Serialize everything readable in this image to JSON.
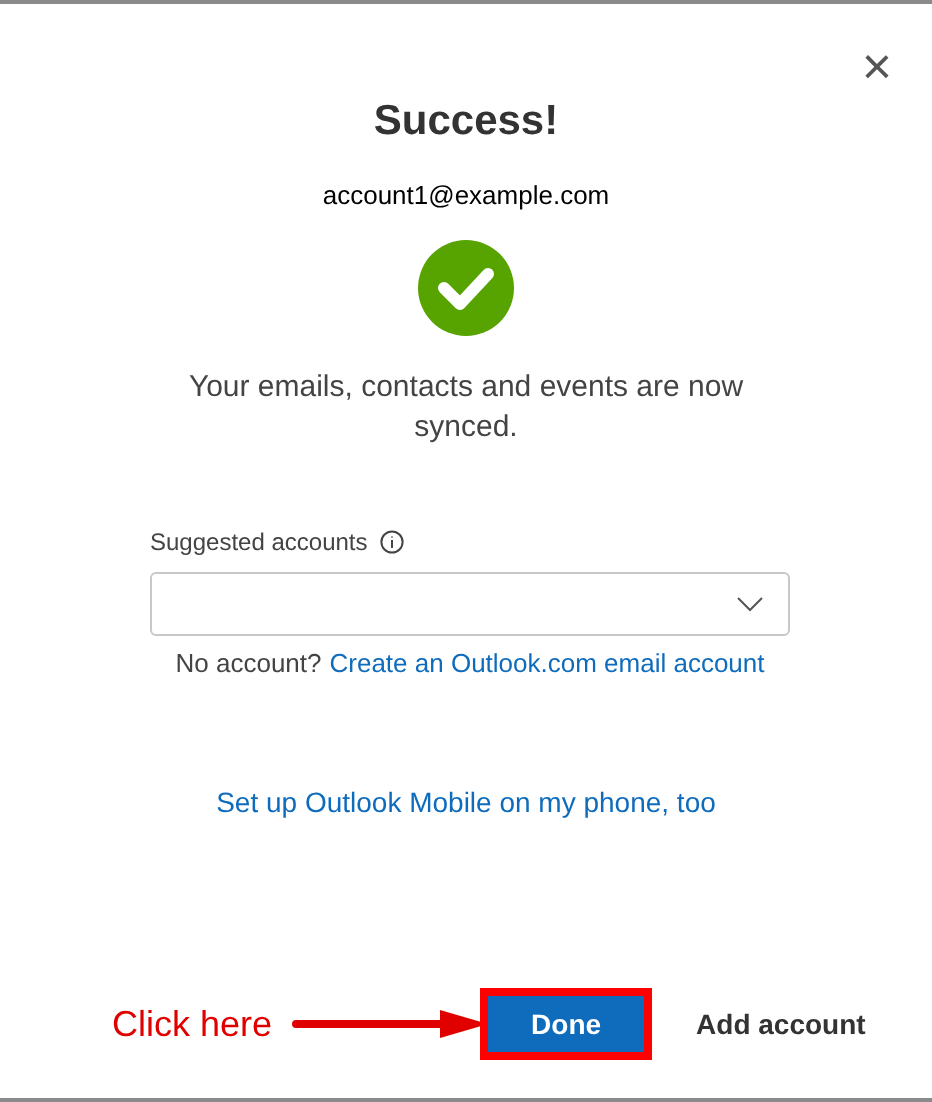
{
  "dialog": {
    "title": "Success!",
    "account": "account1@example.com",
    "message": "Your emails, contacts and events are now synced.",
    "close_symbol": "×"
  },
  "suggested_accounts": {
    "label": "Suggested accounts",
    "expanded": false
  },
  "create_account": {
    "prompt": "No account?",
    "link": "Create an Outlook.com email account"
  },
  "mobile_link": "Set up Outlook Mobile on my phone, too",
  "annotation": {
    "text": "Click here"
  },
  "buttons": [
    {
      "label": "Done",
      "kind": "primary",
      "highlighted": true
    },
    {
      "label": "Add account",
      "kind": "secondary",
      "highlighted": false
    }
  ]
}
